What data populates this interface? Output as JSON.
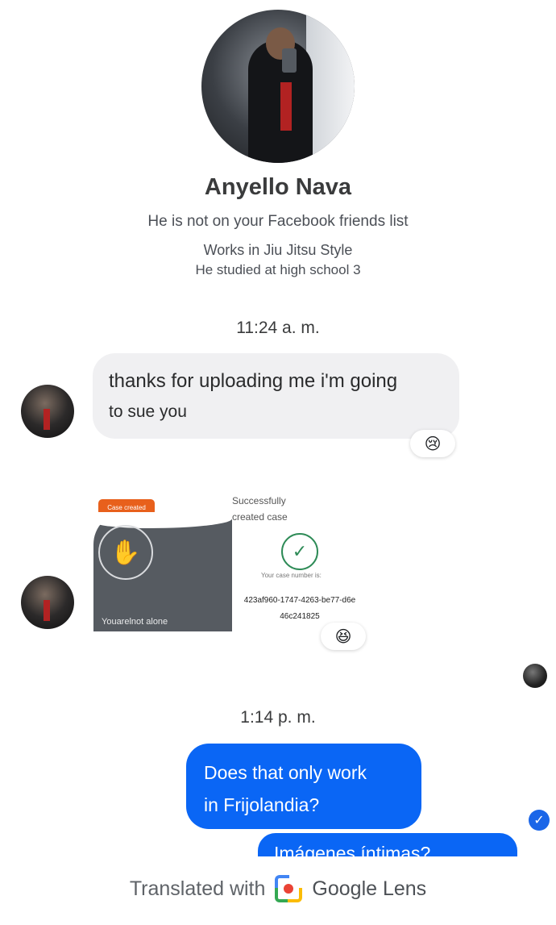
{
  "profile": {
    "name": "Anyello Nava",
    "friend_status": "He is not on your Facebook friends list",
    "work": "Works in Jiu Jitsu Style",
    "education": "He studied at high school 3"
  },
  "timestamps": [
    "11:24 a. m.",
    "1:14 p. m."
  ],
  "incoming_message": {
    "line1": "thanks for uploading me i'm going",
    "line2": "to sue you",
    "reaction": "😢"
  },
  "image_attachment": {
    "case_badge": "Case created",
    "hands_icon": "helping-hands-icon",
    "footer_text": "Youarelnot alone",
    "success_text": "Successfully created case",
    "case_number_label": "Your case number is:",
    "case_number": "423af960-1747-4263-be77-d6e 46c241825",
    "reaction": "😆"
  },
  "outgoing_message": {
    "line1": "Does that only work",
    "line2": "in Frijolandia?",
    "seen_icon": "check-circle-icon"
  },
  "outgoing_message_cut": "Imágenes íntimas?",
  "footer": {
    "prefix": "Translated with",
    "brand": "Google Lens"
  },
  "colors": {
    "outgoing_bubble": "#0a66f5",
    "incoming_bubble": "#f0f0f2",
    "case_badge": "#e8601c",
    "success_check": "#2e8b57"
  }
}
